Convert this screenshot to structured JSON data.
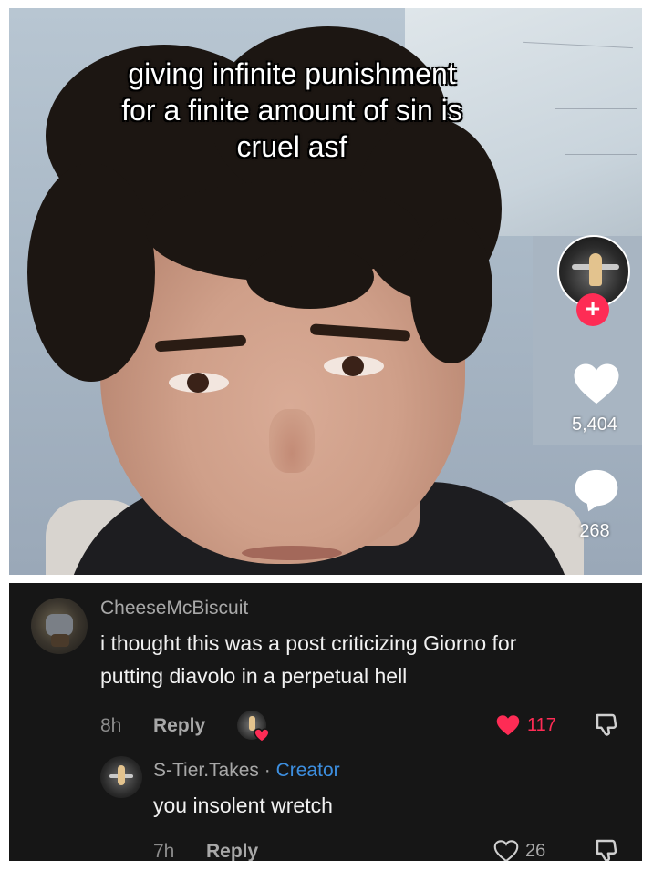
{
  "video": {
    "caption": [
      "giving infinite punishment",
      "for a finite amount of sin is",
      "cruel asf"
    ],
    "follow_symbol": "+",
    "likes": "5,404",
    "comments": "268"
  },
  "comments": [
    {
      "author": "CheeseMcBiscuit",
      "text_lines": [
        "i thought this was a post criticizing Giorno for",
        "putting diavolo in a perpetual hell"
      ],
      "time": "8h",
      "reply_label": "Reply",
      "likes": "117",
      "liked": true
    },
    {
      "author": "S-Tier.Takes",
      "separator": " · ",
      "badge": "Creator",
      "text": "you insolent wretch",
      "time": "7h",
      "reply_label": "Reply",
      "likes": "26",
      "liked": false
    }
  ],
  "colors": {
    "like_red": "#fe2c55",
    "creator_blue": "#3d8fe0",
    "panel_bg": "#161616"
  },
  "icons": [
    "plus-icon",
    "heart-icon",
    "comment-bubble-icon",
    "dislike-icon"
  ]
}
